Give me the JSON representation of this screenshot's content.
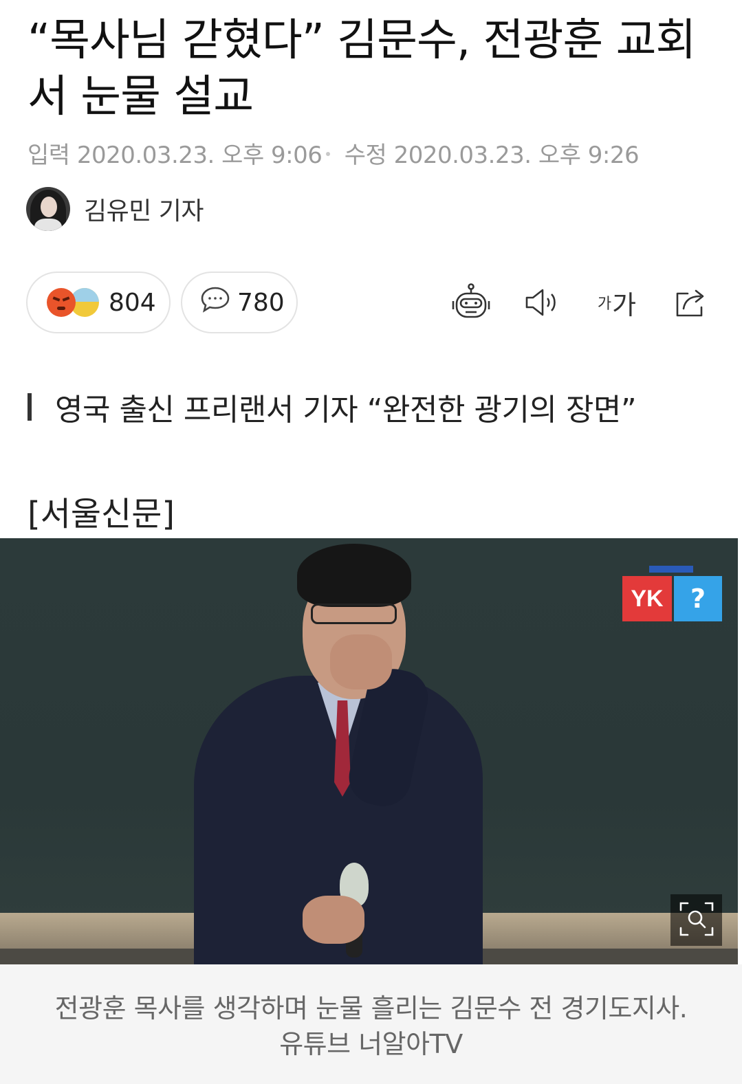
{
  "article": {
    "headline": "“목사님 갇혔다” 김문수, 전광훈 교회서 눈물 설교",
    "published_label": "입력",
    "published": "2020.03.23. 오후 9:06",
    "modified_label": "수정",
    "modified": "2020.03.23. 오후 9:26",
    "author": "김유민 기자",
    "subtitle": "영국 출신 프리랜서 기자 “완전한 광기의 장면”",
    "source": "[서울신문]"
  },
  "reactions": {
    "reaction_count": "804",
    "comment_count": "780"
  },
  "toolbar": {
    "font_size_small": "가",
    "font_size_large": "가"
  },
  "photo": {
    "logo_left": "YK",
    "logo_right": "?",
    "caption_line1": "전광훈 목사를 생각하며 눈물 흘리는 김문수 전 경기도지사.",
    "caption_line2": "유튜브 너알아TV"
  },
  "colors": {
    "meta_gray": "#9a9a9a",
    "caption_bg": "#f5f5f5",
    "angry_emoji": "#e9542a",
    "logo_red": "#e33a3a",
    "logo_blue": "#35a3e8"
  }
}
